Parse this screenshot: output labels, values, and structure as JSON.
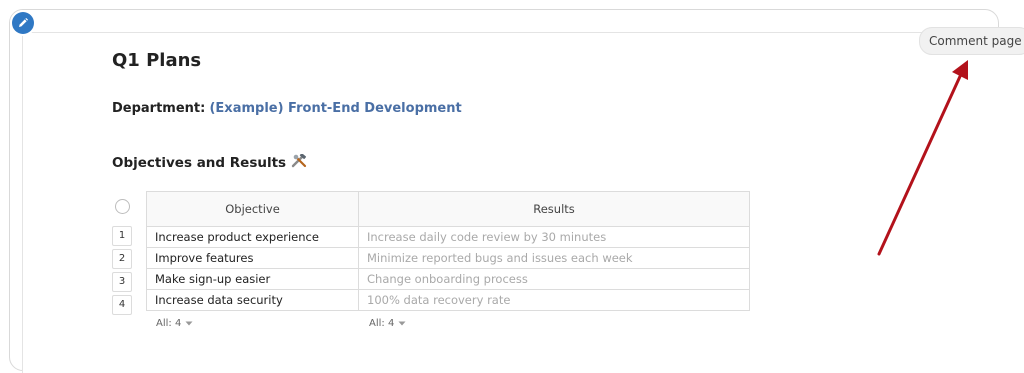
{
  "comment_button": {
    "label": "Comment page"
  },
  "page": {
    "title": "Q1 Plans",
    "department_label": "Department:",
    "department_value": "(Example) Front-End Development",
    "section_heading": "Objectives and Results"
  },
  "table": {
    "columns": [
      "Objective",
      "Results"
    ],
    "rows": [
      {
        "num": "1",
        "objective": "Increase product experience",
        "result": "Increase daily code review by 30 minutes"
      },
      {
        "num": "2",
        "objective": "Improve features",
        "result": "Minimize reported bugs and issues each week"
      },
      {
        "num": "3",
        "objective": "Make sign-up easier",
        "result": "Change onboarding process"
      },
      {
        "num": "4",
        "objective": "Increase data security",
        "result": "100% data recovery rate"
      }
    ],
    "footer": {
      "objective_count": "All: 4",
      "results_count": "All: 4"
    }
  },
  "annotation": {
    "arrow_color": "#b3121b"
  },
  "colors": {
    "accent": "#2f78c4",
    "department_link": "#4a6fa5"
  },
  "icons": {
    "edit": "pencil-icon",
    "section": "tools-icon",
    "dropdown": "caret-down-icon"
  }
}
